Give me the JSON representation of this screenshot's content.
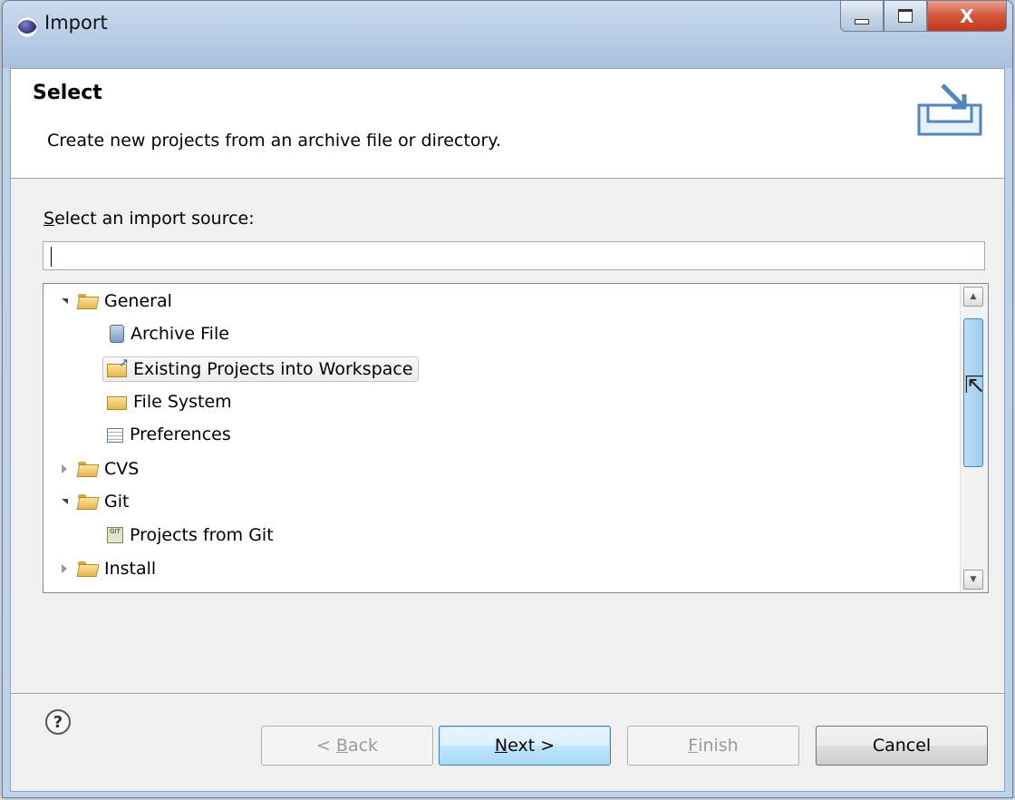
{
  "window": {
    "title": "Import"
  },
  "banner": {
    "heading": "Select",
    "description": "Create new projects from an archive file or directory."
  },
  "source": {
    "label_mnemonic": "S",
    "label_rest": "elect an import source:",
    "filter_value": "",
    "filter_placeholder": ""
  },
  "tree": {
    "items": [
      {
        "label": "General",
        "level": 0,
        "expanded": true,
        "kind": "folder"
      },
      {
        "label": "Archive File",
        "level": 1,
        "kind": "archive-icon"
      },
      {
        "label": "Existing Projects into Workspace",
        "level": 1,
        "kind": "existing-projects-icon",
        "selected": true
      },
      {
        "label": "File System",
        "level": 1,
        "kind": "file-system-icon"
      },
      {
        "label": "Preferences",
        "level": 1,
        "kind": "preferences-icon"
      },
      {
        "label": "CVS",
        "level": 0,
        "expanded": false,
        "kind": "folder"
      },
      {
        "label": "Git",
        "level": 0,
        "expanded": true,
        "kind": "folder"
      },
      {
        "label": "Projects from Git",
        "level": 1,
        "kind": "git-icon"
      },
      {
        "label": "Install",
        "level": 0,
        "expanded": false,
        "kind": "folder"
      }
    ]
  },
  "buttons": {
    "help": "?",
    "back_prefix": "< ",
    "back_mnemonic": "B",
    "back_rest": "ack",
    "next_mnemonic": "N",
    "next_rest": "ext >",
    "finish_mnemonic": "F",
    "finish_rest": "inish",
    "cancel": "Cancel"
  },
  "caption": {
    "close": "X"
  }
}
